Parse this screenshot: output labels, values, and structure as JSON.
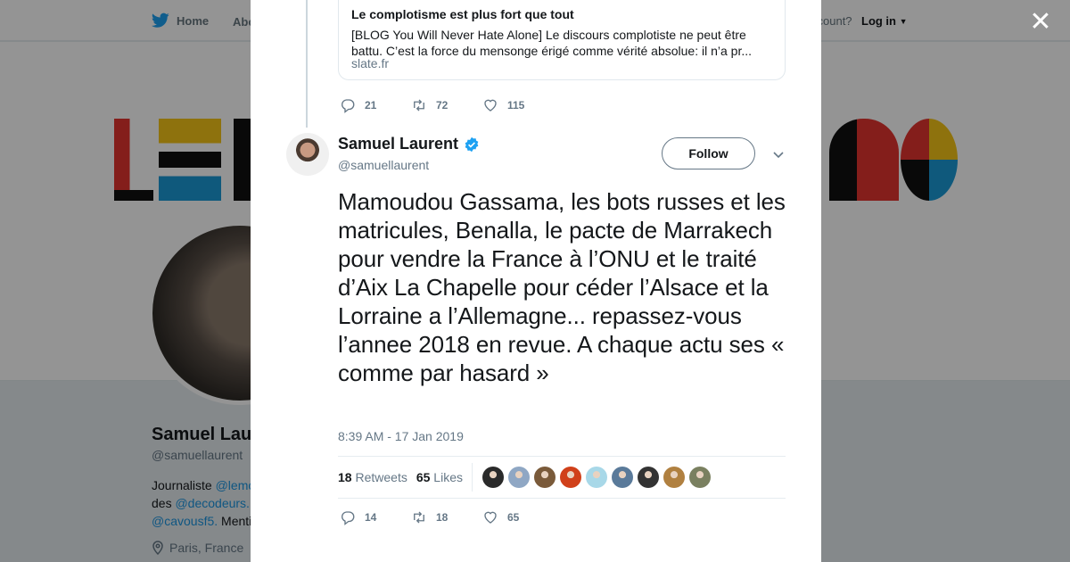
{
  "nav": {
    "home_label": "Home",
    "about_label": "Abo",
    "account_prompt": "ccount?",
    "login_label": "Log in"
  },
  "profile": {
    "name": "Samuel Lau",
    "handle": "@samuellaurent",
    "bio_line1_prefix": "Journaliste ",
    "bio_line1_mention": "@lemo",
    "bio_line2_prefix": "des ",
    "bio_line2_mention": "@decodeurs.",
    "bio_line3_mention": "@cavousf5.",
    "bio_line3_suffix": " Menti",
    "location": "Paris, France"
  },
  "banner": {
    "colors": [
      "#e3342f",
      "#1b9ad6",
      "#f5c518",
      "#111111"
    ]
  },
  "quoted_card": {
    "title": "Le complotisme est plus fort que tout",
    "description": "[BLOG You Will Never Hate Alone] Le discours complotiste ne peut être battu. C’est la force du mensonge érigé comme vérité absolue: il n’a pr...",
    "domain": "slate.fr"
  },
  "prev_tweet_actions": {
    "replies": "21",
    "retweets": "72",
    "likes": "115"
  },
  "tweet": {
    "author_name": "Samuel Laurent",
    "author_handle": "@samuellaurent",
    "follow_label": "Follow",
    "text": "Mamoudou Gassama, les bots russes et les matricules, Benalla, le pacte de Marrakech pour vendre la France à l’ONU et le traité d’Aix La Chapelle pour céder l’Alsace et la Lorraine a l’Allemagne... repassez-vous l’annee 2018 en revue. A chaque actu ses « comme par hasard »",
    "timestamp": "8:39 AM - 17 Jan 2019",
    "retweet_count": "18",
    "retweet_label": "Retweets",
    "like_count": "65",
    "like_label": "Likes",
    "liker_colors": [
      "#2a2a2a",
      "#8fa7c4",
      "#7a5a3a",
      "#d0401a",
      "#a8d8e8",
      "#5a7a9a",
      "#333333",
      "#b08040",
      "#7a8060"
    ],
    "actions": {
      "replies": "14",
      "retweets": "18",
      "likes": "65"
    }
  },
  "colors": {
    "accent": "#1da1f2",
    "text": "#14171a",
    "secondary": "#657786"
  },
  "icons": [
    "twitter-bird-icon",
    "close-icon",
    "reply-icon",
    "retweet-icon",
    "heart-icon",
    "verified-badge-icon",
    "chevron-down-icon",
    "location-pin-icon"
  ]
}
